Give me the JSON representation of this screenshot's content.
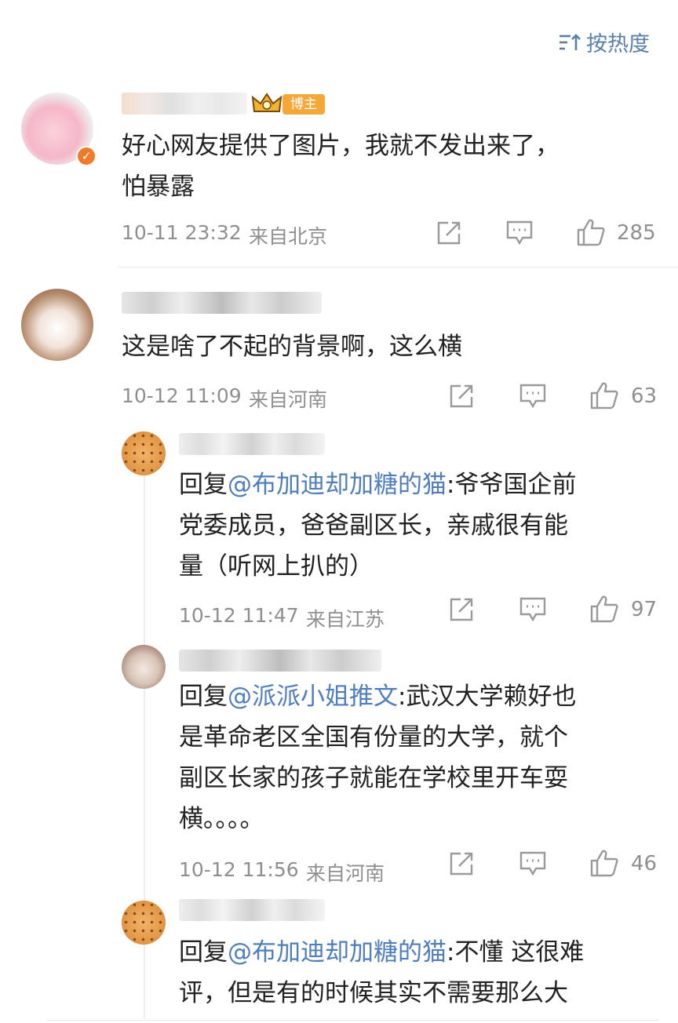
{
  "sort": {
    "label": "按热度"
  },
  "comments": [
    {
      "badge": "博主",
      "text": "好心网友提供了图片，我就不发出来了，",
      "text2": "怕暴露",
      "time": "10-11 23:32",
      "location": "来自北京",
      "likes": "285"
    },
    {
      "text": "这是啥了不起的背景啊，这么横",
      "time": "10-12 11:09",
      "location": "来自河南",
      "likes": "63",
      "replies": [
        {
          "prefix": "回复",
          "mention": "@布加迪却加糖的猫",
          "text_lines": [
            ":爷爷国企前",
            "党委成员，爸爸副区长，亲戚很有能",
            "量（听网上扒的）"
          ],
          "time": "10-12 11:47",
          "location": "来自江苏",
          "likes": "97"
        },
        {
          "prefix": "回复",
          "mention": "@派派小姐推文",
          "text_lines": [
            ":武汉大学赖好也",
            "是革命老区全国有份量的大学，就个",
            "副区长家的孩子就能在学校里开车耍",
            "横。。。。"
          ],
          "time": "10-12 11:56",
          "location": "来自河南",
          "likes": "46"
        },
        {
          "prefix": "回复",
          "mention": "@布加迪却加糖的猫",
          "text_lines": [
            ":不懂 这很难",
            "评，但是有的时候其实不需要那么大"
          ]
        }
      ]
    }
  ]
}
